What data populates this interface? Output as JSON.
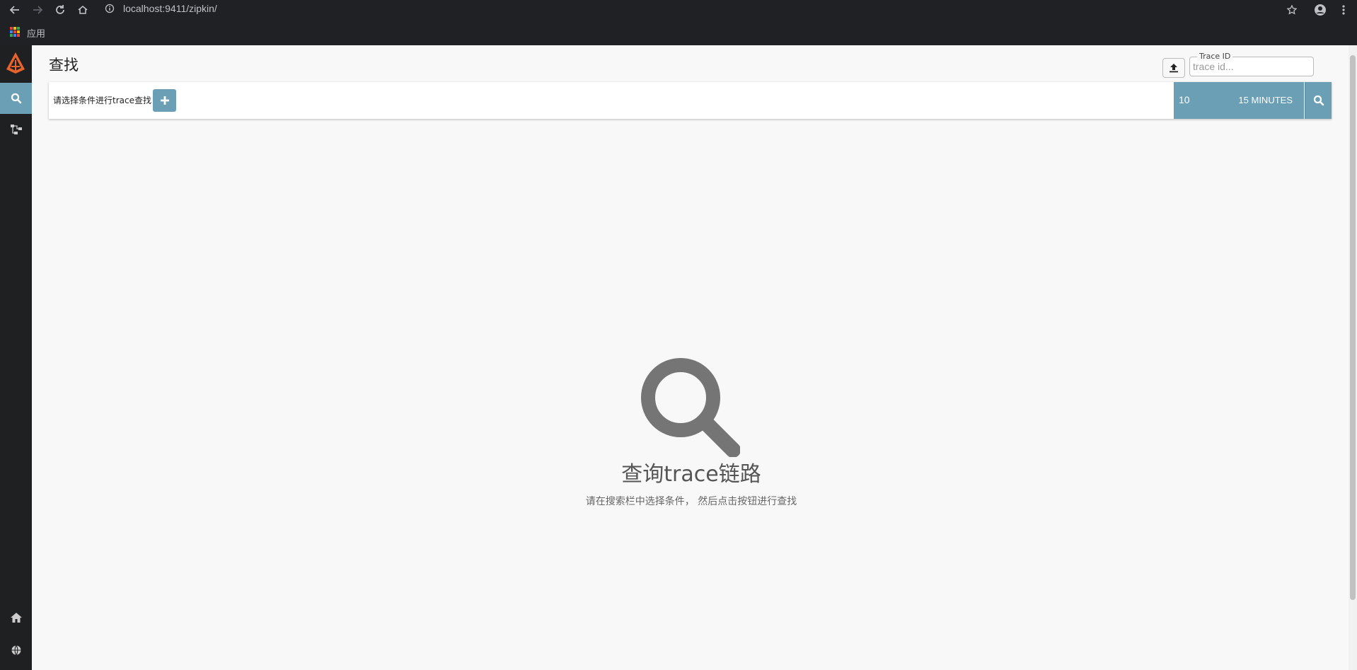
{
  "browser": {
    "url": "localhost:9411/zipkin/",
    "bookmarks_apps_label": "应用"
  },
  "sidebar": {
    "items": [
      {
        "name": "search",
        "icon": "search-icon"
      },
      {
        "name": "dependencies",
        "icon": "dependencies-icon"
      },
      {
        "name": "home",
        "icon": "home-icon"
      },
      {
        "name": "language",
        "icon": "globe-icon"
      }
    ]
  },
  "header": {
    "title": "查找",
    "trace_id_label": "Trace ID",
    "trace_id_placeholder": "trace id..."
  },
  "search_bar": {
    "prompt": "请选择条件进行trace查找",
    "limit": "10",
    "lookback": "15 MINUTES"
  },
  "empty_state": {
    "title": "查询trace链路",
    "subtitle": "请在搜索栏中选择条件， 然后点击按钮进行查找"
  },
  "colors": {
    "accent": "#6a9fb5",
    "sidebar_bg": "#1e2021",
    "brand": "#e8642c"
  }
}
